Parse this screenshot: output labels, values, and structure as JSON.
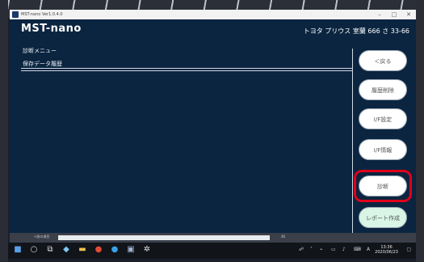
{
  "window": {
    "title": "MST-nano Ver1.0.4.0",
    "minimize": "–",
    "maximize": "□",
    "close": "✕"
  },
  "header": {
    "brand": "MST-nano",
    "vehicle": "トヨタ プリウス 室蘭 666 さ 33-66"
  },
  "breadcrumb": {
    "level1": "診断メニュー",
    "level2": "保存データ履歴"
  },
  "buttons": {
    "back": "＜戻る",
    "delete_history": "履歴削除",
    "if_settings": "I/F設定",
    "if_info": "I/F情報",
    "diagnose": "診断",
    "create_report": "レポート作成"
  },
  "statusbar": {
    "left_text": "<前の項目",
    "zoom": "46"
  },
  "taskbar": {
    "clock_time": "13:36",
    "clock_date": "2020/06/23",
    "ime": "A"
  },
  "colors": {
    "window_bg": "#0b2540",
    "highlight": "#e1001a",
    "report_bg": "#d8f5e6"
  }
}
